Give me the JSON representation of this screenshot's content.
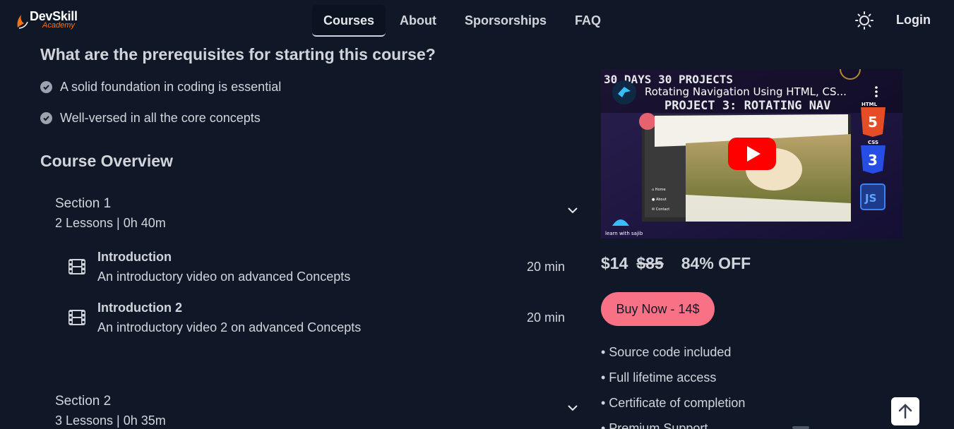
{
  "brand": {
    "name": "DevSkill",
    "sub": "Academy"
  },
  "nav": {
    "links": [
      "Courses",
      "About",
      "Sporsorships",
      "FAQ"
    ],
    "login": "Login"
  },
  "prerequisites": {
    "title": "What are the prerequisites for starting this course?",
    "items": [
      "A solid foundation in coding is essential",
      "Well-versed in all the core concepts"
    ]
  },
  "overview": {
    "title": "Course Overview",
    "sections": [
      {
        "name": "Section 1",
        "meta": "2 Lessons | 0h 40m",
        "lessons": [
          {
            "title": "Introduction",
            "desc": "An introductory video on advanced Concepts",
            "duration": "20 min"
          },
          {
            "title": "Introduction 2",
            "desc": "An introductory video 2 on advanced Concepts",
            "duration": "20 min"
          }
        ]
      },
      {
        "name": "Section 2",
        "meta": "3 Lessons | 0h 35m"
      }
    ]
  },
  "video": {
    "title": "Rotating Navigation Using HTML, CS...",
    "banner": "30 DAYS 30 PROJECTS",
    "subtitle": "PROJECT 3: ROTATING NAV",
    "channel": "learn with sajib",
    "badges": [
      "HTML",
      "CSS"
    ]
  },
  "pricing": {
    "price": "$14",
    "old_price": "$85",
    "discount": "84% OFF",
    "buy_label": "Buy Now - 14$"
  },
  "features": [
    "• Source code included",
    "• Full lifetime access",
    "• Certificate of completion",
    "• Premium Support"
  ],
  "colors": {
    "background": "#101828",
    "accent": "#f87185",
    "brand_orange": "#f97316"
  }
}
